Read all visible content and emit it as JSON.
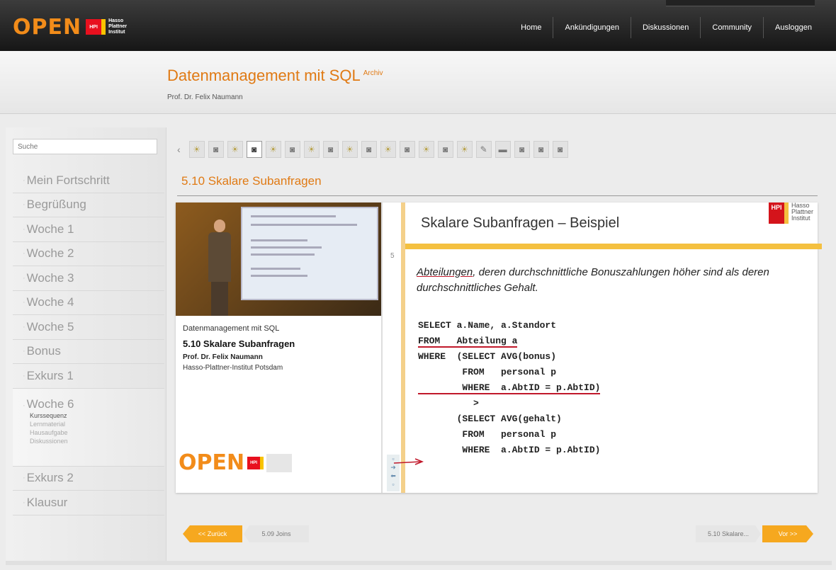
{
  "brand": {
    "open": "OPEN",
    "hpi": "HPI",
    "line1": "Hasso",
    "line2": "Plattner",
    "line3": "Institut"
  },
  "nav": [
    "Home",
    "Ankündigungen",
    "Diskussionen",
    "Community",
    "Ausloggen"
  ],
  "course": {
    "title": "Datenmanagement mit SQL",
    "badge": "Archiv",
    "professor": "Prof. Dr. Felix Naumann"
  },
  "search": {
    "placeholder": "Suche"
  },
  "sidebar": {
    "items": [
      "Mein Fortschritt",
      "Begrüßung",
      "Woche 1",
      "Woche 2",
      "Woche 3",
      "Woche 4",
      "Woche 5",
      "Bonus",
      "Exkurs 1",
      "Woche 6",
      "Exkurs 2",
      "Klausur"
    ],
    "week6_sub": [
      "Kurssequenz",
      "Lernmaterial",
      "Hausaufgabe",
      "Diskussionen"
    ]
  },
  "lesson": {
    "section_title": "5.10 Skalare Subanfragen",
    "icons": [
      "bulb",
      "camera",
      "bulb",
      "camera",
      "bulb",
      "camera",
      "bulb",
      "camera",
      "bulb",
      "camera",
      "bulb",
      "camera",
      "bulb",
      "camera",
      "bulb",
      "edit",
      "card",
      "camera",
      "camera",
      "camera"
    ]
  },
  "video_meta": {
    "course": "Datenmanagement mit SQL",
    "title": "5.10 Skalare Subanfragen",
    "professor": "Prof. Dr. Felix Naumann",
    "institute": "Hasso-Plattner-Institut Potsdam"
  },
  "slide": {
    "title": "Skalare Subanfragen – Beispiel",
    "number": "5",
    "text_u": "Abteilungen",
    "text_rest": ", deren durchschnittliche Bonuszahlungen höher sind als deren durchschnittliches Gehalt.",
    "code": [
      "SELECT a.Name, a.Standort",
      "FROM   Abteilung a",
      "WHERE  (SELECT AVG(bonus)",
      "        FROM   personal p",
      "        WHERE  a.AbtID = p.AbtID)",
      "          >",
      "       (SELECT AVG(gehalt)",
      "        FROM   personal p",
      "        WHERE  a.AbtID = p.AbtID)"
    ]
  },
  "pager": {
    "prev_button": "<< Zurück",
    "prev_label": "5.09 Joins",
    "next_label": "5.10 Skalare...",
    "next_button": "Vor >>"
  }
}
